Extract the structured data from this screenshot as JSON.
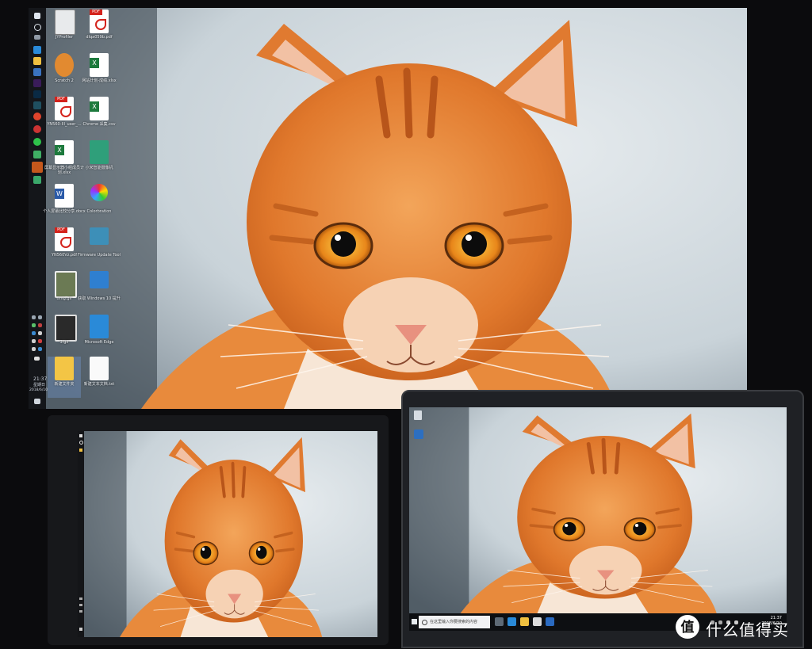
{
  "main_monitor": {
    "taskbar": {
      "clock_time": "21:37",
      "clock_day": "星期日",
      "clock_date": "2018/6/10"
    },
    "desktop_icons": [
      {
        "label": "JYProfiler",
        "type": "app"
      },
      {
        "label": "dlqa059b.pdf",
        "type": "pdf"
      },
      {
        "label": "Scratch 2",
        "type": "app"
      },
      {
        "label": "网站计划-成绩.xlsx",
        "type": "xls"
      },
      {
        "label": "YN560-III_user_...",
        "type": "pdf"
      },
      {
        "label": "Chrome 采集.csv",
        "type": "xls"
      },
      {
        "label": "屏幕显示器小组成员计划.xlsx",
        "type": "xls"
      },
      {
        "label": "小米智能摄像机",
        "type": "app"
      },
      {
        "label": "个人屏幕比较分享.docx",
        "type": "doc"
      },
      {
        "label": "Colorbration",
        "type": "app"
      },
      {
        "label": "YN560Vz.pdf",
        "type": "pdf"
      },
      {
        "label": "Firmware Update Tool",
        "type": "app"
      },
      {
        "label": "timg.gif",
        "type": "img"
      },
      {
        "label": "获取 Windows 10 提升",
        "type": "app"
      },
      {
        "label": "3.gif",
        "type": "img"
      },
      {
        "label": "Microsoft Edge",
        "type": "app"
      },
      {
        "label": "新建文件夹",
        "type": "folder"
      },
      {
        "label": "新建文本文档.txt",
        "type": "txt"
      }
    ]
  },
  "laptop": {
    "search_placeholder": "在这里输入你要搜索的内容",
    "clock_time": "21:37",
    "clock_date": "2018/6/10"
  },
  "watermark": {
    "text": "什么值得买"
  },
  "colors": {
    "wallpaper_bg": "#c9d4da",
    "cat_orange": "#e88a3c",
    "cat_eye": "#e89a1e",
    "taskbar": "#14161a"
  }
}
